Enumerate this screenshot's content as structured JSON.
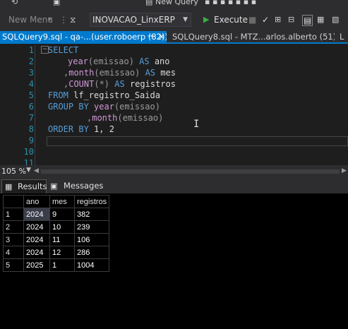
{
  "toolbar": {
    "new_query_label": "New Query",
    "new_menu_label": "New Menu",
    "database": "INOVACAO_LinxERP",
    "execute_label": "Execute"
  },
  "tabs": [
    {
      "label": "SQLQuery9.sql - qa-...(user.roboerp (82))*",
      "active": true
    },
    {
      "label": "SQLQuery8.sql - MTZ...arlos.alberto (51))*",
      "active": false
    }
  ],
  "editor": {
    "line_numbers": [
      "1",
      "2",
      "3",
      "4",
      "5",
      "6",
      "7",
      "8",
      "9",
      "10",
      "11"
    ],
    "line1": {
      "kw": "SELECT"
    },
    "line2": {
      "fn": "year",
      "rest1": "(emissao) ",
      "kw": "AS",
      "rest2": " ano"
    },
    "line3": {
      "g1": ",",
      "fn": "month",
      "rest1": "(emissao) ",
      "kw": "AS",
      "rest2": " mes"
    },
    "line4": {
      "g1": ",",
      "fn": "COUNT",
      "g2": "(*) ",
      "kw": "AS",
      "rest2": " registros"
    },
    "line5": {
      "kw": "FROM",
      "rest": " lf_registro_Saida"
    },
    "line6": {
      "kw": "GROUP BY",
      "fn": " year",
      "rest": "(emissao)"
    },
    "line7": {
      "g1": ",",
      "fn": "month",
      "rest": "(emissao)"
    },
    "line8": {
      "kw": "ORDER BY",
      "rest": " 1, 2"
    }
  },
  "status": {
    "zoom": "105 %"
  },
  "results_tabs": {
    "results": "Results",
    "messages": "Messages"
  },
  "grid": {
    "columns": [
      "ano",
      "mes",
      "registros"
    ],
    "rows": [
      {
        "n": "1",
        "ano": "2024",
        "mes": "9",
        "registros": "382"
      },
      {
        "n": "2",
        "ano": "2024",
        "mes": "10",
        "registros": "239"
      },
      {
        "n": "3",
        "ano": "2024",
        "mes": "11",
        "registros": "106"
      },
      {
        "n": "4",
        "ano": "2024",
        "mes": "12",
        "registros": "286"
      },
      {
        "n": "5",
        "ano": "2025",
        "mes": "1",
        "registros": "1004"
      }
    ]
  },
  "colors": {
    "accent": "#007acc",
    "keyword": "#569cd6",
    "function": "#d197d9",
    "line_number": "#2b91af"
  },
  "icons": [
    "new-query-icon",
    "execute-play-icon",
    "parse-check-icon",
    "stop-icon",
    "close-icon",
    "pin-icon",
    "results-grid-icon",
    "messages-icon"
  ]
}
